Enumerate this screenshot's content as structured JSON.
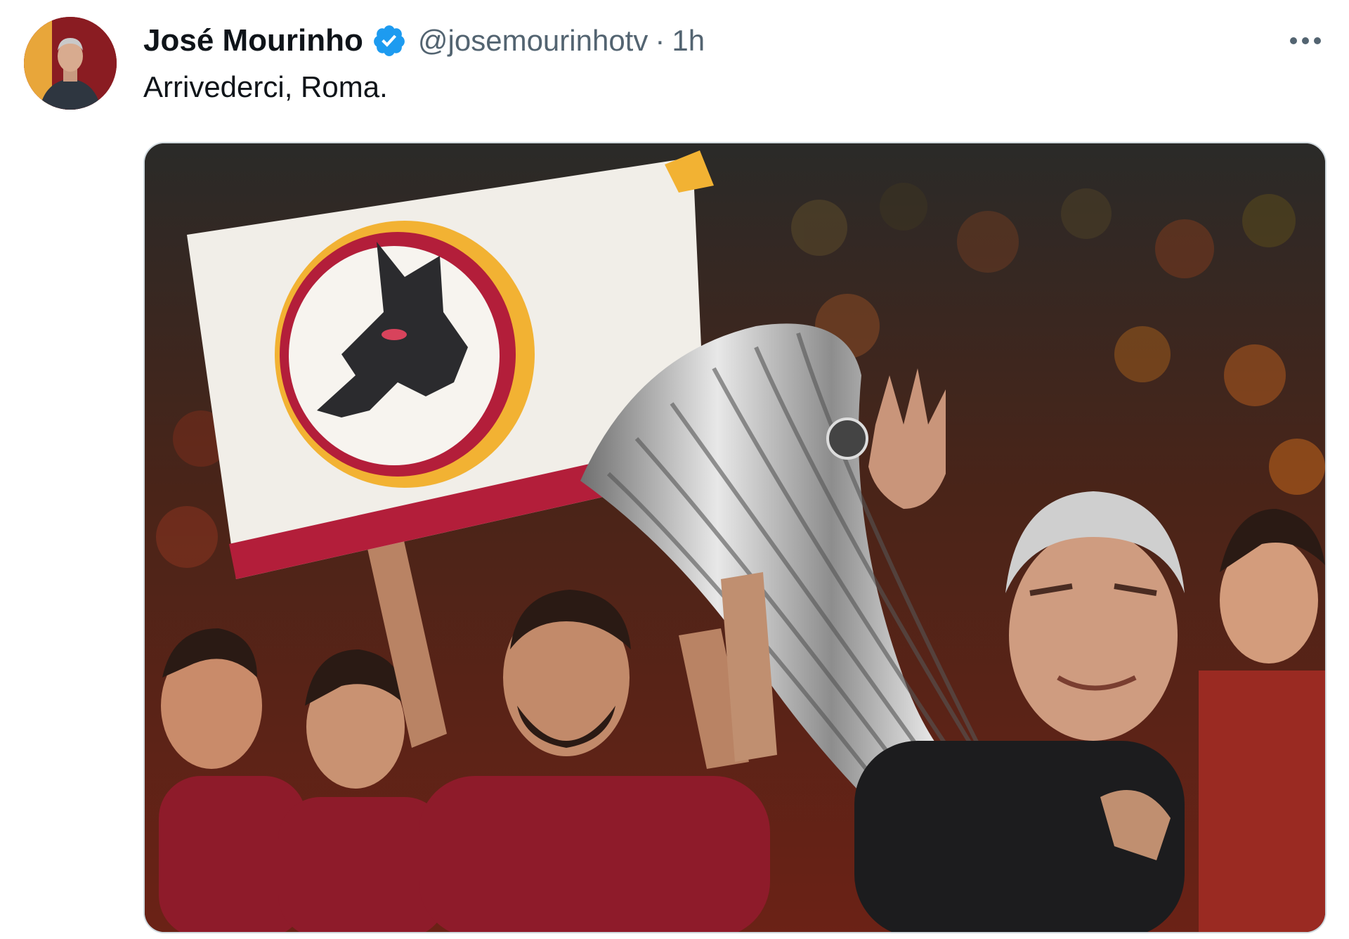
{
  "tweet": {
    "author": {
      "display_name": "José Mourinho",
      "handle": "@josemourinhotv",
      "verified": true
    },
    "separator": "·",
    "timestamp": "1h",
    "text": "Arrivederci, Roma.",
    "media": {
      "description_icon": "photo-icon"
    }
  },
  "colors": {
    "verified_blue": "#1d9bf0",
    "text_primary": "#0f1419",
    "text_secondary": "#536471",
    "roma_maroon": "#8e1b2a",
    "roma_yellow": "#f2b233"
  }
}
